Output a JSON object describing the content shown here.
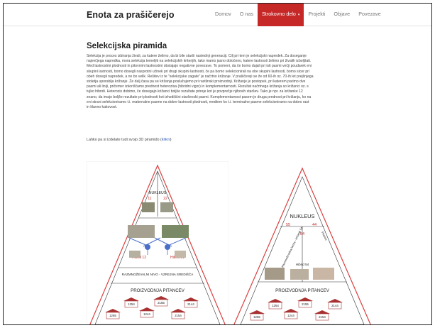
{
  "site": {
    "logo": "Enota za prašičerejo"
  },
  "nav": {
    "items": [
      "Domov",
      "O nas",
      "Strokovno delo",
      "Projekti",
      "Objave",
      "Povezave"
    ],
    "caret": "▾"
  },
  "page": {
    "title": "Selekcijska piramida",
    "lines": [
      "Selekcija je proces izbiranja živali, za katere želimo, da bi bile starši naslednji generaciji. Cilj pri tem je selekcijski napredek. Za doseganje",
      "največjega napredka, mora selekcija temeljiti na selekcijskih kriterijih, tako mamo jasno določeno, katere lastnosti želimo pri živalih izboljšati.",
      "Med lastnostmi plodnosti in pitovnimi lastnostmi obstajajo negativne povezave. To pomeni, da če bomo dajali pri isti pasmi večji poudarek eni",
      "skupini lastnosti, bomo dosegli nasprotni učinek pri drugi skupini lastnosti, če pa bomo selekcionirali na obe skupini lastnosti, bomo sicer pri",
      "obeh dosegli napredek, a ne bo velik. Rešitev iz te \"selekcijske zagate\" je načrtno križanje. V prašičereji se že od 60-ih oz. 70-ih let prejšnjega",
      "stoletja uporablja križanje. Že dalj časa pa se križanja poslužujemo pri rastlinski proizvodnji. Križanje je postopek, pri katerem parimo dve",
      "pasmi ali liniji, pričemer izkoriščamo prednost heterozisa (hibridni vigor) in komplementarnosti. Rezultat načrtnega križanja so križanci oz. s",
      "tujko hibridi. Heterozis dobimo, če dosegajo križanci boljše rezultate prireje kot je povprečje njihovih staršev. Tako je npr. za križanke 12",
      "znano, da imajo boljše rezultate pri plodnosti kot izhodiščni starševski pasmi. Komplementarnost pasem je druga prednost pri križanju, ko na",
      "eni strani selekcioniramo t.i. maternalne pasme na dobre lastnosti plodnosti, medtem ko t.i. terminalne pasme selekcioniramo na dobro rast",
      "in klavno kakovost."
    ],
    "link_prefix": "Lahko pa si izdelate tudi svojo 3D piramido (",
    "link_text": "klikni",
    "link_suffix": ")"
  },
  "pyramid_left": {
    "nucleus": "NUKLEUS",
    "n1": "11",
    "n2": "22",
    "hybrid_a": "Hibrid 12",
    "hybrid_b": "Hibrid 21",
    "level": "RAZMNOŽEVALNI NIVO - VZREJNA SREDIŠČA",
    "production": "PROIZVODNJA PITANCEV",
    "farms": [
      "1254",
      "2155",
      "2144",
      "1255",
      "1244",
      "2154"
    ]
  },
  "pyramid_right": {
    "nucleus": "NUKLEUS",
    "n1": "55",
    "n2": "44",
    "n3": "54",
    "left_side": "Razmnoževalna farma - križanje 54",
    "right_side": "Pitanec",
    "hybrid": "Hibrid 54",
    "production": "PROIZVODNJA PITANCEV",
    "farms": [
      "1254",
      "2155",
      "2144",
      "1255",
      "1244",
      "2154"
    ]
  },
  "colors": {
    "accent": "#c62828",
    "pyramid_outline": "#d94040",
    "barn": "#a83232",
    "blue": "#4a6fc9"
  }
}
